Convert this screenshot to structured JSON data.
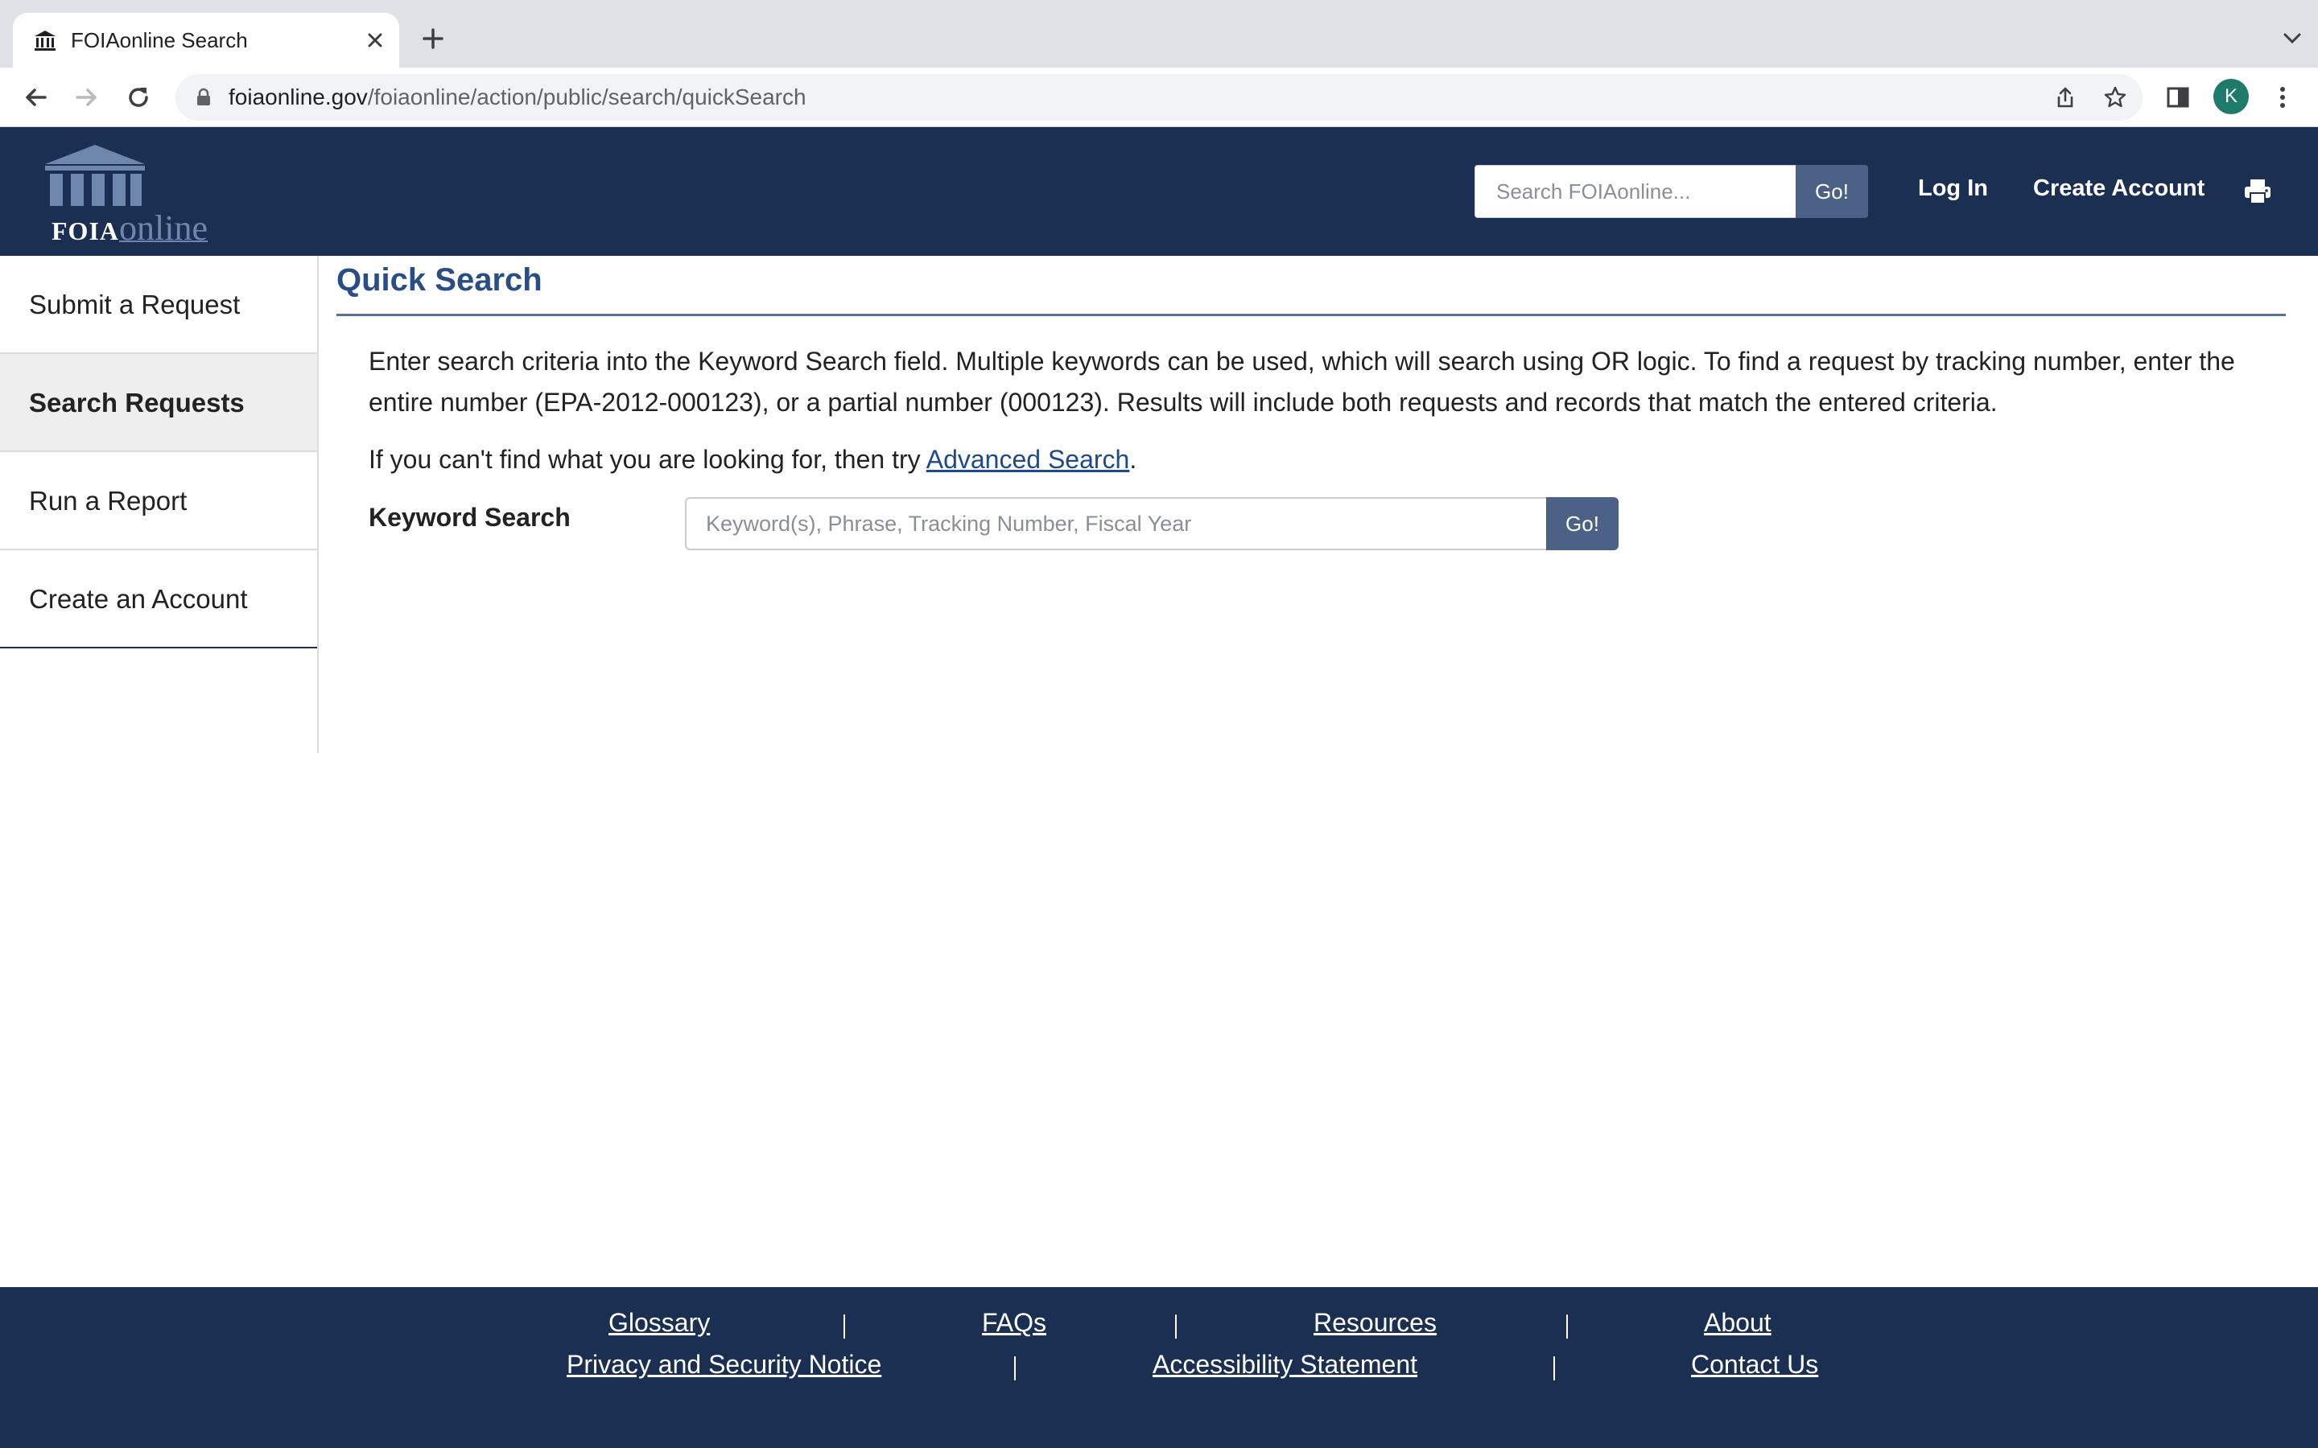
{
  "browser": {
    "tab_title": "FOIAonline Search",
    "url_host": "foiaonline.gov",
    "url_path": "/foiaonline/action/public/search/quickSearch",
    "profile_initial": "K"
  },
  "header": {
    "logo_foia": "FOIA",
    "logo_online": "online",
    "search_placeholder": "Search FOIAonline...",
    "search_go": "Go!",
    "login": "Log In",
    "create_account": "Create Account",
    "print_icon": "printer-icon"
  },
  "sidebar": {
    "items": [
      {
        "label": "Submit a Request",
        "active": false
      },
      {
        "label": "Search Requests",
        "active": true
      },
      {
        "label": "Run a Report",
        "active": false
      },
      {
        "label": "Create an Account",
        "active": false
      }
    ]
  },
  "main": {
    "title": "Quick Search",
    "description": "Enter search criteria into the Keyword Search field. Multiple keywords can be used, which will search using OR logic. To find a request by tracking number, enter the entire number (EPA-2012-000123), or a partial number (000123). Results will include both requests and records that match the entered criteria.",
    "try_prefix": "If you can't find what you are looking for, then try ",
    "try_link": "Advanced Search",
    "try_suffix": ".",
    "keyword_label": "Keyword Search",
    "keyword_placeholder": "Keyword(s), Phrase, Tracking Number, Fiscal Year",
    "keyword_go": "Go!"
  },
  "footer": {
    "row1": [
      "Glossary",
      "FAQs",
      "Resources",
      "About"
    ],
    "row2": [
      "Privacy and Security Notice",
      "Accessibility Statement",
      "Contact Us"
    ]
  },
  "colors": {
    "header_bg": "#1b2f52",
    "accent": "#2a4d86",
    "button": "#4c6186"
  }
}
